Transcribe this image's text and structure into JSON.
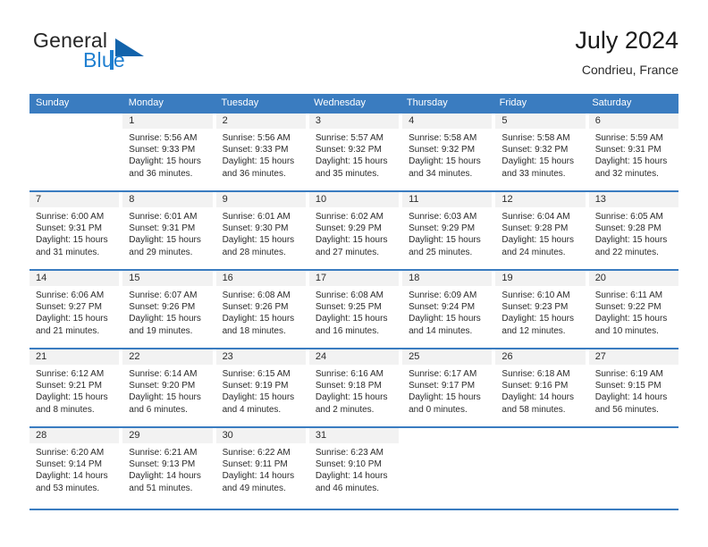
{
  "brand": {
    "name_part1": "General",
    "name_part2": "Blue",
    "logo_icon": "blue-triangle-icon"
  },
  "header": {
    "title": "July 2024",
    "subtitle": "Condrieu, France"
  },
  "colors": {
    "header_blue": "#3a7cc0",
    "brand_blue": "#1f7fd0",
    "logo_triangle": "#1263ab",
    "daynum_band": "#f2f2f2",
    "text": "#2b2b2b"
  },
  "weekdays": [
    "Sunday",
    "Monday",
    "Tuesday",
    "Wednesday",
    "Thursday",
    "Friday",
    "Saturday"
  ],
  "weeks": [
    [
      {
        "day": "",
        "sunrise": "",
        "sunset": "",
        "daylight1": "",
        "daylight2": ""
      },
      {
        "day": "1",
        "sunrise": "Sunrise: 5:56 AM",
        "sunset": "Sunset: 9:33 PM",
        "daylight1": "Daylight: 15 hours",
        "daylight2": "and 36 minutes."
      },
      {
        "day": "2",
        "sunrise": "Sunrise: 5:56 AM",
        "sunset": "Sunset: 9:33 PM",
        "daylight1": "Daylight: 15 hours",
        "daylight2": "and 36 minutes."
      },
      {
        "day": "3",
        "sunrise": "Sunrise: 5:57 AM",
        "sunset": "Sunset: 9:32 PM",
        "daylight1": "Daylight: 15 hours",
        "daylight2": "and 35 minutes."
      },
      {
        "day": "4",
        "sunrise": "Sunrise: 5:58 AM",
        "sunset": "Sunset: 9:32 PM",
        "daylight1": "Daylight: 15 hours",
        "daylight2": "and 34 minutes."
      },
      {
        "day": "5",
        "sunrise": "Sunrise: 5:58 AM",
        "sunset": "Sunset: 9:32 PM",
        "daylight1": "Daylight: 15 hours",
        "daylight2": "and 33 minutes."
      },
      {
        "day": "6",
        "sunrise": "Sunrise: 5:59 AM",
        "sunset": "Sunset: 9:31 PM",
        "daylight1": "Daylight: 15 hours",
        "daylight2": "and 32 minutes."
      }
    ],
    [
      {
        "day": "7",
        "sunrise": "Sunrise: 6:00 AM",
        "sunset": "Sunset: 9:31 PM",
        "daylight1": "Daylight: 15 hours",
        "daylight2": "and 31 minutes."
      },
      {
        "day": "8",
        "sunrise": "Sunrise: 6:01 AM",
        "sunset": "Sunset: 9:31 PM",
        "daylight1": "Daylight: 15 hours",
        "daylight2": "and 29 minutes."
      },
      {
        "day": "9",
        "sunrise": "Sunrise: 6:01 AM",
        "sunset": "Sunset: 9:30 PM",
        "daylight1": "Daylight: 15 hours",
        "daylight2": "and 28 minutes."
      },
      {
        "day": "10",
        "sunrise": "Sunrise: 6:02 AM",
        "sunset": "Sunset: 9:29 PM",
        "daylight1": "Daylight: 15 hours",
        "daylight2": "and 27 minutes."
      },
      {
        "day": "11",
        "sunrise": "Sunrise: 6:03 AM",
        "sunset": "Sunset: 9:29 PM",
        "daylight1": "Daylight: 15 hours",
        "daylight2": "and 25 minutes."
      },
      {
        "day": "12",
        "sunrise": "Sunrise: 6:04 AM",
        "sunset": "Sunset: 9:28 PM",
        "daylight1": "Daylight: 15 hours",
        "daylight2": "and 24 minutes."
      },
      {
        "day": "13",
        "sunrise": "Sunrise: 6:05 AM",
        "sunset": "Sunset: 9:28 PM",
        "daylight1": "Daylight: 15 hours",
        "daylight2": "and 22 minutes."
      }
    ],
    [
      {
        "day": "14",
        "sunrise": "Sunrise: 6:06 AM",
        "sunset": "Sunset: 9:27 PM",
        "daylight1": "Daylight: 15 hours",
        "daylight2": "and 21 minutes."
      },
      {
        "day": "15",
        "sunrise": "Sunrise: 6:07 AM",
        "sunset": "Sunset: 9:26 PM",
        "daylight1": "Daylight: 15 hours",
        "daylight2": "and 19 minutes."
      },
      {
        "day": "16",
        "sunrise": "Sunrise: 6:08 AM",
        "sunset": "Sunset: 9:26 PM",
        "daylight1": "Daylight: 15 hours",
        "daylight2": "and 18 minutes."
      },
      {
        "day": "17",
        "sunrise": "Sunrise: 6:08 AM",
        "sunset": "Sunset: 9:25 PM",
        "daylight1": "Daylight: 15 hours",
        "daylight2": "and 16 minutes."
      },
      {
        "day": "18",
        "sunrise": "Sunrise: 6:09 AM",
        "sunset": "Sunset: 9:24 PM",
        "daylight1": "Daylight: 15 hours",
        "daylight2": "and 14 minutes."
      },
      {
        "day": "19",
        "sunrise": "Sunrise: 6:10 AM",
        "sunset": "Sunset: 9:23 PM",
        "daylight1": "Daylight: 15 hours",
        "daylight2": "and 12 minutes."
      },
      {
        "day": "20",
        "sunrise": "Sunrise: 6:11 AM",
        "sunset": "Sunset: 9:22 PM",
        "daylight1": "Daylight: 15 hours",
        "daylight2": "and 10 minutes."
      }
    ],
    [
      {
        "day": "21",
        "sunrise": "Sunrise: 6:12 AM",
        "sunset": "Sunset: 9:21 PM",
        "daylight1": "Daylight: 15 hours",
        "daylight2": "and 8 minutes."
      },
      {
        "day": "22",
        "sunrise": "Sunrise: 6:14 AM",
        "sunset": "Sunset: 9:20 PM",
        "daylight1": "Daylight: 15 hours",
        "daylight2": "and 6 minutes."
      },
      {
        "day": "23",
        "sunrise": "Sunrise: 6:15 AM",
        "sunset": "Sunset: 9:19 PM",
        "daylight1": "Daylight: 15 hours",
        "daylight2": "and 4 minutes."
      },
      {
        "day": "24",
        "sunrise": "Sunrise: 6:16 AM",
        "sunset": "Sunset: 9:18 PM",
        "daylight1": "Daylight: 15 hours",
        "daylight2": "and 2 minutes."
      },
      {
        "day": "25",
        "sunrise": "Sunrise: 6:17 AM",
        "sunset": "Sunset: 9:17 PM",
        "daylight1": "Daylight: 15 hours",
        "daylight2": "and 0 minutes."
      },
      {
        "day": "26",
        "sunrise": "Sunrise: 6:18 AM",
        "sunset": "Sunset: 9:16 PM",
        "daylight1": "Daylight: 14 hours",
        "daylight2": "and 58 minutes."
      },
      {
        "day": "27",
        "sunrise": "Sunrise: 6:19 AM",
        "sunset": "Sunset: 9:15 PM",
        "daylight1": "Daylight: 14 hours",
        "daylight2": "and 56 minutes."
      }
    ],
    [
      {
        "day": "28",
        "sunrise": "Sunrise: 6:20 AM",
        "sunset": "Sunset: 9:14 PM",
        "daylight1": "Daylight: 14 hours",
        "daylight2": "and 53 minutes."
      },
      {
        "day": "29",
        "sunrise": "Sunrise: 6:21 AM",
        "sunset": "Sunset: 9:13 PM",
        "daylight1": "Daylight: 14 hours",
        "daylight2": "and 51 minutes."
      },
      {
        "day": "30",
        "sunrise": "Sunrise: 6:22 AM",
        "sunset": "Sunset: 9:11 PM",
        "daylight1": "Daylight: 14 hours",
        "daylight2": "and 49 minutes."
      },
      {
        "day": "31",
        "sunrise": "Sunrise: 6:23 AM",
        "sunset": "Sunset: 9:10 PM",
        "daylight1": "Daylight: 14 hours",
        "daylight2": "and 46 minutes."
      },
      {
        "day": "",
        "sunrise": "",
        "sunset": "",
        "daylight1": "",
        "daylight2": ""
      },
      {
        "day": "",
        "sunrise": "",
        "sunset": "",
        "daylight1": "",
        "daylight2": ""
      },
      {
        "day": "",
        "sunrise": "",
        "sunset": "",
        "daylight1": "",
        "daylight2": ""
      }
    ]
  ]
}
